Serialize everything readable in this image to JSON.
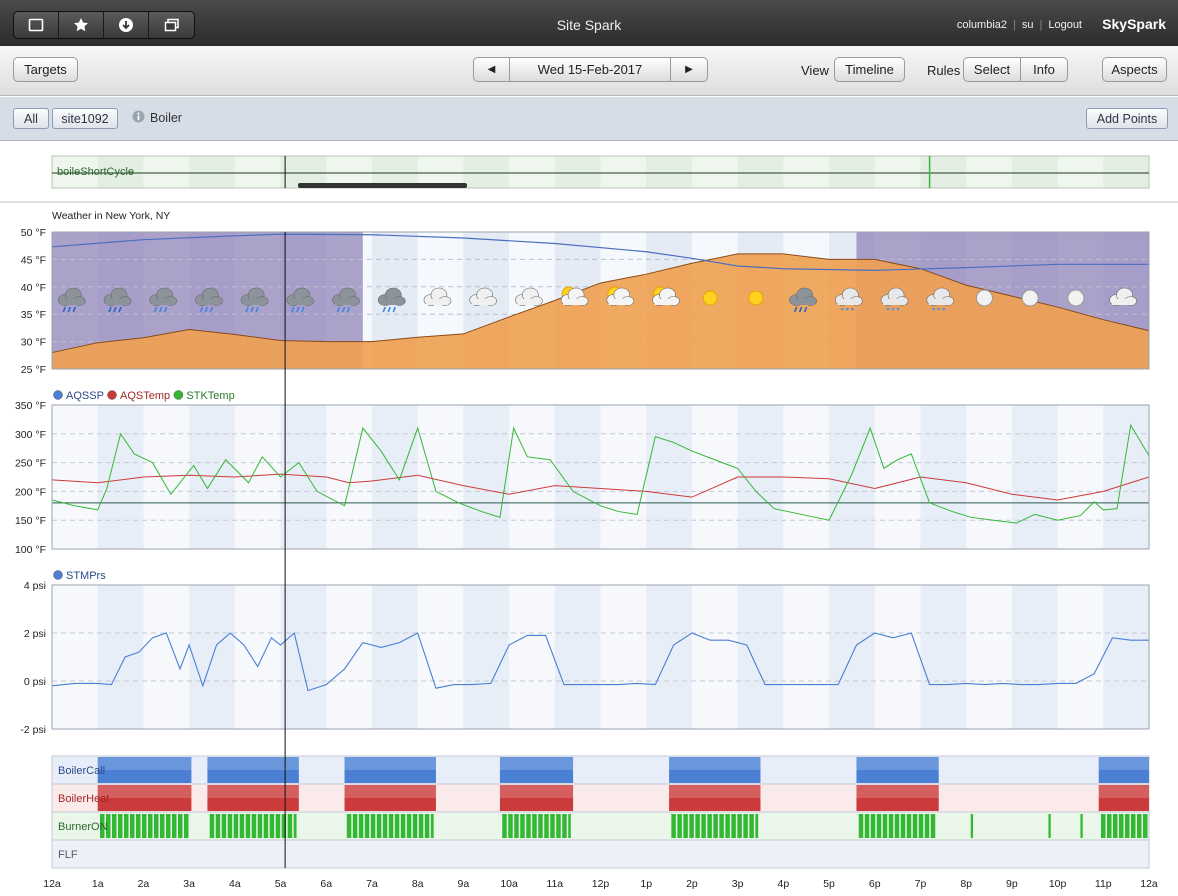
{
  "titlebar": {
    "app_title": "Site Spark",
    "user": "columbia2",
    "role": "su",
    "logout": "Logout",
    "brand": "SkySpark",
    "icons": [
      "window-icon",
      "star-icon",
      "download-icon",
      "windows-icon"
    ]
  },
  "toolbar": {
    "targets": "Targets",
    "date": "Wed 15-Feb-2017",
    "prev": "◀",
    "next": "▶",
    "view_label": "View",
    "view_value": "Timeline",
    "rules_label": "Rules",
    "select": "Select",
    "info": "Info",
    "aspects": "Aspects"
  },
  "filterbar": {
    "all": "All",
    "site": "site1092",
    "equip": "Boiler",
    "add_points": "Add Points"
  },
  "colors": {
    "blue": "#4a7fd4",
    "red": "#cc3b3b",
    "green": "#33b833",
    "orange": "#f0a050",
    "night": "#8b7db5"
  },
  "chart_data": [
    {
      "type": "timeline",
      "row_label": "boileShortCycle",
      "events_hours": [
        19.2
      ]
    },
    {
      "type": "area",
      "title": "Weather in New York, NY",
      "ylim": [
        25,
        50
      ],
      "y_ticks": [
        "50 °F",
        "45 °F",
        "40 °F",
        "35 °F",
        "30 °F",
        "25 °F"
      ],
      "temperature": {
        "x_hours": [
          0,
          1,
          2,
          3,
          4,
          5,
          6,
          7,
          8,
          9,
          10,
          11,
          12,
          13,
          14,
          15,
          16,
          17,
          18,
          19,
          20,
          21,
          22,
          23,
          24
        ],
        "values": [
          28,
          29.8,
          30.7,
          32.2,
          31.3,
          30.2,
          30,
          30,
          30.8,
          31.4,
          34.5,
          37.5,
          40.7,
          42.3,
          44.3,
          46,
          46,
          45,
          45,
          43.3,
          40.3,
          38.3,
          36.3,
          34,
          32
        ]
      },
      "dewpoint": {
        "x_hours": [
          0,
          2,
          4,
          5,
          7,
          9,
          11,
          13,
          14,
          15,
          16,
          18,
          20,
          22,
          24
        ],
        "values": [
          47.3,
          48.6,
          49.3,
          49.6,
          49.5,
          48.9,
          47.9,
          46.4,
          45.2,
          43.8,
          43.3,
          43,
          43.5,
          44.1,
          44.1
        ]
      },
      "night_periods": [
        [
          0,
          6.8
        ],
        [
          17.6,
          24
        ]
      ],
      "conditions": [
        "rain",
        "rain",
        "sleet",
        "sleet",
        "sleet",
        "sleet",
        "sleet",
        "sleet",
        "cloudy",
        "cloudy",
        "cloudy",
        "partly-sunny",
        "partly-sunny",
        "partly-sunny",
        "sunny",
        "sunny",
        "rain",
        "snow",
        "snow",
        "snow",
        "moon",
        "moon",
        "moon",
        "cloudy"
      ]
    },
    {
      "type": "line",
      "ylim": [
        100,
        350
      ],
      "y_ticks": [
        "350 °F",
        "300 °F",
        "250 °F",
        "200 °F",
        "150 °F",
        "100 °F"
      ],
      "series": [
        {
          "name": "AQSSP",
          "color": "#4a7fd4",
          "x_hours": [
            0,
            24
          ],
          "values": [
            180,
            180
          ]
        },
        {
          "name": "AQSTemp",
          "color": "#cc3b3b",
          "x_hours": [
            0,
            1,
            2,
            3,
            4,
            5,
            6,
            6.5,
            7,
            8,
            9,
            10,
            11,
            12,
            13,
            14,
            15,
            16,
            17,
            18,
            19,
            20,
            21,
            22,
            23,
            24
          ],
          "values": [
            220,
            215,
            225,
            228,
            225,
            230,
            225,
            215,
            218,
            228,
            210,
            195,
            210,
            205,
            200,
            190,
            225,
            225,
            222,
            205,
            225,
            215,
            195,
            185,
            200,
            225
          ]
        },
        {
          "name": "STKTemp",
          "color": "#33b833",
          "x_hours": [
            0,
            0.5,
            1,
            1.2,
            1.5,
            1.8,
            2.2,
            2.6,
            3.1,
            3.4,
            3.8,
            4.3,
            4.6,
            5,
            5.4,
            5.8,
            6.4,
            6.8,
            7.2,
            7.6,
            8,
            8.4,
            8.9,
            9.4,
            9.8,
            10.1,
            10.4,
            10.9,
            11.4,
            12,
            12.4,
            12.8,
            13.2,
            13.6,
            14,
            14.5,
            15,
            15.4,
            15.8,
            16.4,
            17,
            17.5,
            17.9,
            18.2,
            18.5,
            18.8,
            19.2,
            19.7,
            20.1,
            20.6,
            21.1,
            21.5,
            22,
            22.5,
            22.8,
            23,
            23.3,
            23.6,
            24
          ],
          "values": [
            185,
            175,
            168,
            205,
            300,
            265,
            250,
            195,
            245,
            205,
            255,
            215,
            260,
            225,
            250,
            200,
            175,
            310,
            270,
            220,
            310,
            200,
            180,
            165,
            155,
            310,
            260,
            255,
            200,
            175,
            165,
            160,
            295,
            285,
            270,
            255,
            240,
            200,
            170,
            160,
            150,
            230,
            310,
            240,
            255,
            265,
            180,
            165,
            155,
            150,
            145,
            160,
            150,
            158,
            182,
            168,
            170,
            315,
            262
          ]
        }
      ]
    },
    {
      "type": "line",
      "ylim": [
        -2,
        4
      ],
      "y_ticks": [
        "4 psi",
        "2 psi",
        "0 psi",
        "-2 psi"
      ],
      "series": [
        {
          "name": "STMPrs",
          "color": "#4a7fd4",
          "x_hours": [
            0,
            0.5,
            1,
            1.3,
            1.6,
            1.9,
            2.2,
            2.5,
            2.8,
            3,
            3.3,
            3.6,
            3.9,
            4.2,
            4.5,
            4.8,
            5,
            5.3,
            5.6,
            6,
            6.4,
            6.8,
            7.2,
            7.6,
            8,
            8.4,
            8.8,
            9.2,
            9.6,
            10,
            10.4,
            10.8,
            11.2,
            11.6,
            12,
            12.4,
            12.8,
            13.2,
            13.6,
            14,
            14.4,
            14.8,
            15.2,
            15.6,
            16,
            16.4,
            16.8,
            17.2,
            17.6,
            18,
            18.4,
            18.8,
            19.2,
            19.6,
            20,
            20.4,
            20.8,
            21.2,
            21.6,
            22,
            22.4,
            22.8,
            23.2,
            23.6,
            24
          ],
          "values": [
            -0.2,
            -0.1,
            -0.1,
            -0.15,
            1,
            1.2,
            1.8,
            2,
            0.5,
            1.5,
            -0.2,
            1.5,
            2,
            1.5,
            0.6,
            1.8,
            1.5,
            2,
            -0.4,
            -0.15,
            0.5,
            1.6,
            1.4,
            1.6,
            2,
            -0.3,
            -0.15,
            -0.15,
            -0.1,
            1.5,
            1.9,
            1.9,
            -0.15,
            -0.15,
            -0.15,
            -0.15,
            -0.1,
            -0.15,
            1.5,
            2,
            1.7,
            1.7,
            1.5,
            -0.15,
            -0.15,
            -0.15,
            -0.15,
            -0.15,
            1.5,
            2,
            1.8,
            2,
            -0.15,
            -0.15,
            -0.1,
            -0.15,
            -0.1,
            -0.15,
            -0.15,
            -0.1,
            -0.1,
            0.3,
            1.8,
            1.7,
            1.7
          ]
        }
      ]
    },
    {
      "type": "timeline",
      "rows": [
        {
          "name": "BoilerCall",
          "color": "#4a7fd4",
          "periods": [
            [
              1,
              3.05
            ],
            [
              3.4,
              5.4
            ],
            [
              6.4,
              8.4
            ],
            [
              9.8,
              11.4
            ],
            [
              13.5,
              15.5
            ],
            [
              17.6,
              19.4
            ],
            [
              22.9,
              24
            ]
          ]
        },
        {
          "name": "BoilerHeat",
          "color": "#cc3b3b",
          "periods": [
            [
              1,
              3.05
            ],
            [
              3.4,
              5.4
            ],
            [
              6.4,
              8.4
            ],
            [
              9.8,
              11.4
            ],
            [
              13.5,
              15.5
            ],
            [
              17.6,
              19.4
            ],
            [
              22.9,
              24
            ]
          ]
        },
        {
          "name": "BurnerON",
          "color": "#33b833",
          "periods": [
            [
              1.05,
              3
            ],
            [
              3.45,
              5.35
            ],
            [
              6.45,
              8.35
            ],
            [
              9.85,
              11.35
            ],
            [
              13.55,
              15.45
            ],
            [
              17.65,
              19.35
            ],
            [
              20.1,
              20.15
            ],
            [
              21.8,
              21.85
            ],
            [
              22.5,
              22.55
            ],
            [
              22.95,
              24
            ]
          ]
        },
        {
          "name": "FLF",
          "color": "#9aa",
          "periods": []
        }
      ]
    }
  ],
  "x_axis": {
    "labels": [
      "12a",
      "1a",
      "2a",
      "3a",
      "4a",
      "5a",
      "6a",
      "7a",
      "8a",
      "9a",
      "10a",
      "11a",
      "12p",
      "1p",
      "2p",
      "3p",
      "4p",
      "5p",
      "6p",
      "7p",
      "8p",
      "9p",
      "10p",
      "11p",
      "12a"
    ]
  },
  "cursor_hour": 5.1
}
